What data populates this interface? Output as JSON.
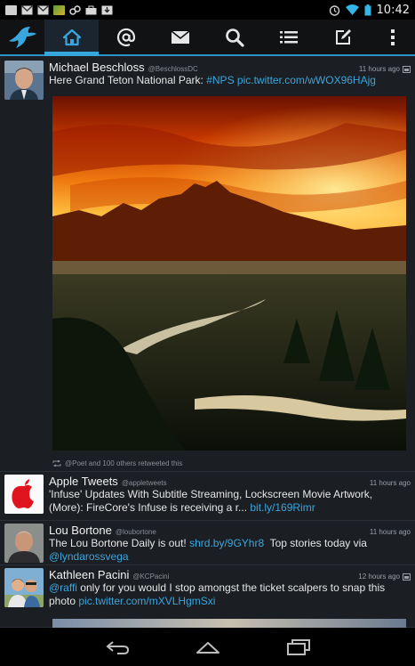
{
  "status_bar": {
    "time": "10:42",
    "icons": [
      "gallery-icon",
      "gmail-icon",
      "gmail-icon",
      "app-icon",
      "link-icon",
      "briefcase-icon",
      "download-icon"
    ],
    "right_icons": [
      "alarm-icon",
      "wifi-icon",
      "battery-icon"
    ]
  },
  "action_bar": {
    "items": [
      "app-logo-icon",
      "home-icon",
      "mentions-icon",
      "messages-icon",
      "search-icon",
      "lists-icon",
      "compose-icon",
      "overflow-menu-icon"
    ],
    "active": "home-icon",
    "accent_color": "#2b93c8"
  },
  "tweets": [
    {
      "name": "Michael Beschloss",
      "handle": "@BeschlossDC",
      "time": "11 hours ago",
      "text": "Here Grand Teton National Park: ",
      "link": "#NPS pic.twitter.com/wWOX96HAjg",
      "retweet": "@Poet and 100 others retweeted this"
    },
    {
      "name": "Apple Tweets",
      "handle": "@appletweets",
      "time": "11 hours ago",
      "text": "'Infuse' Updates With Subtitle Streaming, Lockscreen Movie Artwork, (More): FireCore's Infuse is receiving a r... ",
      "link": "bit.ly/169Rimr"
    },
    {
      "name": "Lou Bortone",
      "handle": "@loubortone",
      "time": "11 hours ago",
      "text_before": "The Lou Bortone Daily is out! ",
      "link1": "shrd.by/9GYhr8",
      "text_middle": "  Top stories today via ",
      "link2": "@lyndarossvega"
    },
    {
      "name": "Kathleen Pacini",
      "handle": "@KCPacini",
      "time": "12 hours ago",
      "link1": "@raffi",
      "text": " only for you would I stop amongst the ticket scalpers to snap this photo ",
      "link2": "pic.twitter.com/mXVLHgmSxi"
    }
  ],
  "nav_bar": {
    "items": [
      "back-icon",
      "home-nav-icon",
      "recents-icon"
    ]
  }
}
